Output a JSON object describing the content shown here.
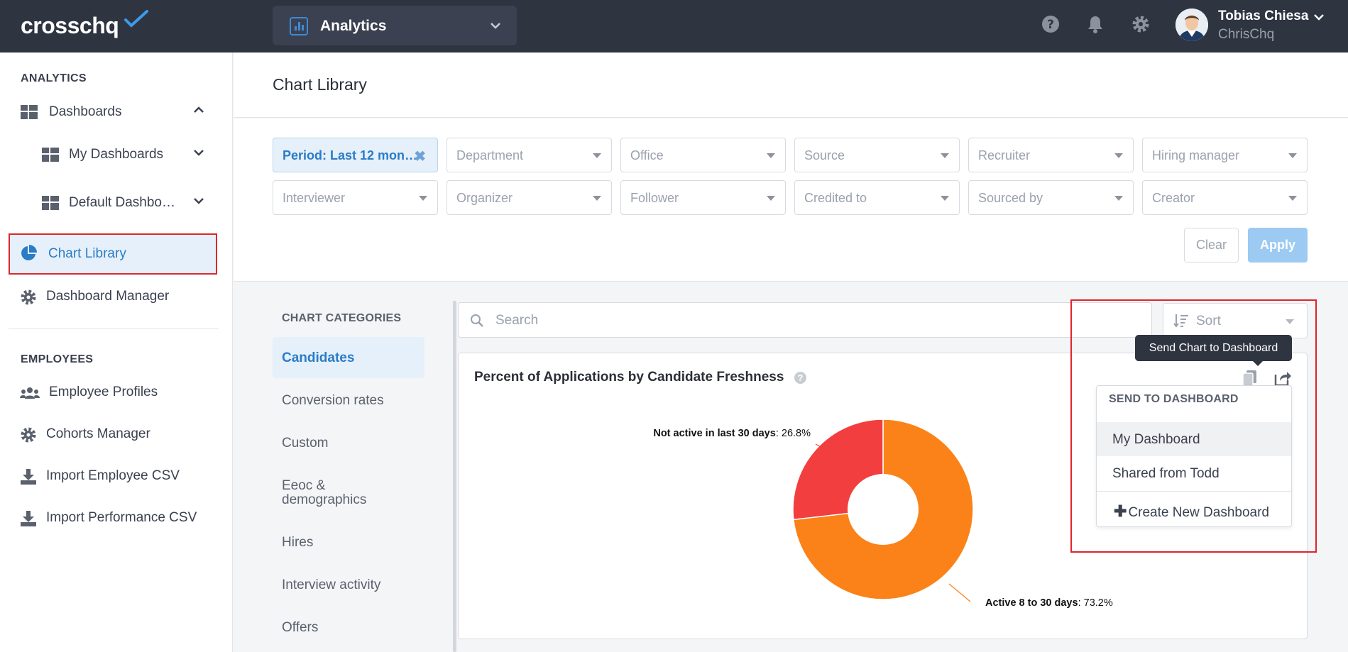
{
  "app": {
    "logo": "crosschq",
    "switcher_label": "Analytics",
    "user_name": "Tobias Chiesa",
    "user_org": "ChrisChq"
  },
  "sidebar": {
    "analytics_heading": "ANALYTICS",
    "items": [
      {
        "label": "Dashboards"
      },
      {
        "label": "My Dashboards"
      },
      {
        "label": "Default Dashbo…"
      },
      {
        "label": "Chart Library"
      },
      {
        "label": "Dashboard Manager"
      }
    ],
    "employees_heading": "EMPLOYEES",
    "employee_items": [
      {
        "label": "Employee Profiles"
      },
      {
        "label": "Cohorts Manager"
      },
      {
        "label": "Import Employee CSV"
      },
      {
        "label": "Import Performance CSV"
      }
    ]
  },
  "page": {
    "title": "Chart Library"
  },
  "filters": {
    "row1": [
      "Period: Last 12 mon…",
      "Department",
      "Office",
      "Source",
      "Recruiter",
      "Hiring manager"
    ],
    "row2": [
      "Interviewer",
      "Organizer",
      "Follower",
      "Credited to",
      "Sourced by",
      "Creator"
    ],
    "clear_label": "Clear",
    "apply_label": "Apply"
  },
  "categories": {
    "title": "CHART CATEGORIES",
    "items": [
      "Candidates",
      "Conversion rates",
      "Custom",
      "Eeoc &",
      "demographics",
      "Hires",
      "Interview activity",
      "Offers"
    ]
  },
  "search": {
    "placeholder": "Search"
  },
  "sort": {
    "label": "Sort"
  },
  "tooltip": {
    "text": "Send Chart to Dashboard"
  },
  "send_menu": {
    "header": "SEND TO DASHBOARD",
    "options": [
      "My Dashboard",
      "Shared from Todd"
    ],
    "create_label": "Create New Dashboard"
  },
  "colors": {
    "accent": "#2a7cc7",
    "slice_active": "#fb8218",
    "slice_inactive": "#f23e3e",
    "highlight": "#e0242b"
  },
  "chart_data": {
    "type": "pie",
    "title": "Percent of Applications by Candidate Freshness",
    "slices": [
      {
        "name": "Active 8 to 30 days",
        "value": 73.2,
        "value_label": "73.2%"
      },
      {
        "name": "Not active in last 30 days",
        "value": 26.8,
        "value_label": "26.8%"
      }
    ]
  }
}
